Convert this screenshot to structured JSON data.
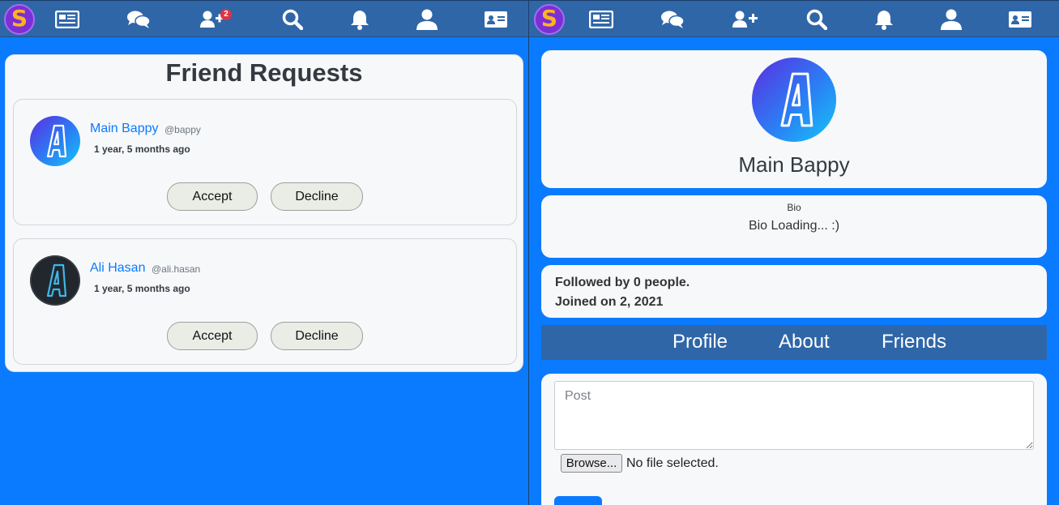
{
  "left": {
    "nav": {
      "logo_letter": "S",
      "friend_badge": "2",
      "icons": [
        "newspaper-icon",
        "comments-icon",
        "user-plus-icon",
        "search-icon",
        "bell-icon",
        "user-icon",
        "id-card-icon"
      ]
    },
    "heading": "Friend Requests",
    "requests": [
      {
        "name": "Main Bappy",
        "handle": "@bappy",
        "time": "1 year, 5 months ago",
        "accept": "Accept",
        "decline": "Decline"
      },
      {
        "name": "Ali Hasan",
        "handle": "@ali.hasan",
        "time": "1 year, 5 months ago",
        "accept": "Accept",
        "decline": "Decline"
      }
    ]
  },
  "right": {
    "nav": {
      "logo_letter": "S"
    },
    "profile": {
      "avatar_letter": "A",
      "name": "Main Bappy",
      "bio_label": "Bio",
      "bio_text": "Bio Loading... :)",
      "followed": "Followed by 0 people.",
      "joined": "Joined on 2, 2021"
    },
    "tabs": [
      "Profile",
      "About",
      "Friends"
    ],
    "post": {
      "placeholder": "Post",
      "browse_label": "Browse...",
      "file_status": "No file selected."
    }
  },
  "colors": {
    "background": "#0a7bff",
    "navbar": "#2f66a8",
    "link": "#0a7bff",
    "badge": "#dc3545"
  }
}
